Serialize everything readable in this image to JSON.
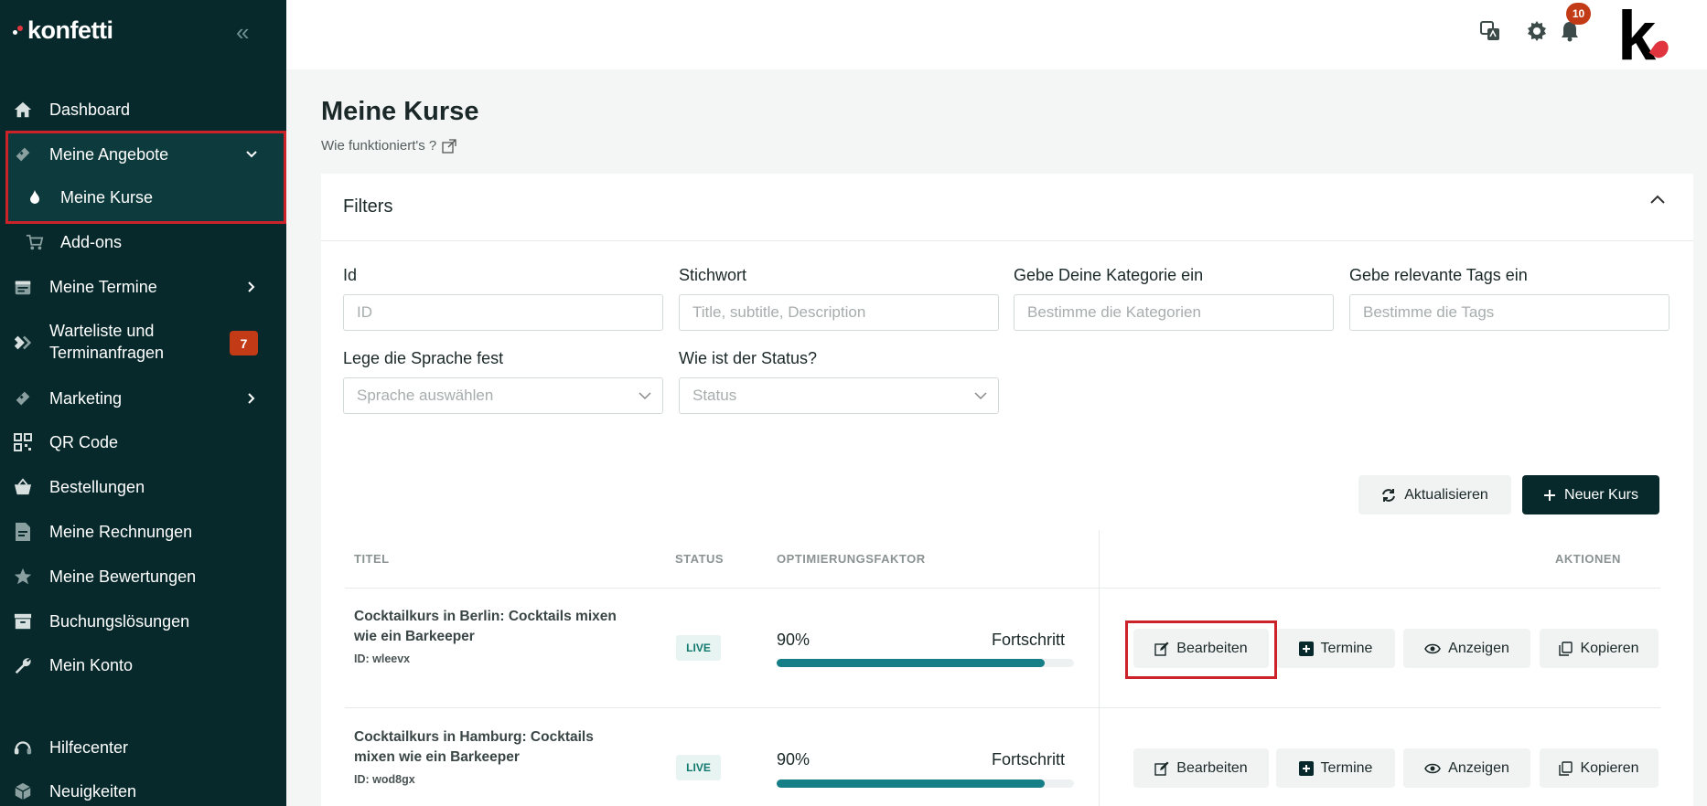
{
  "brand": {
    "name": "konfetti"
  },
  "sidebar": {
    "items": [
      {
        "label": "Dashboard",
        "icon": "home-icon"
      },
      {
        "label": "Meine Angebote",
        "icon": "ticket-icon"
      },
      {
        "label": "Meine Kurse",
        "icon": "flame-icon"
      },
      {
        "label": "Add-ons",
        "icon": "cart-icon"
      },
      {
        "label": "Meine Termine",
        "icon": "calendar-icon"
      },
      {
        "label": "Warteliste und Terminanfragen",
        "line1": "Warteliste und",
        "line2": "Terminanfragen",
        "icon": "waitlist-icon",
        "badge": "7"
      },
      {
        "label": "Marketing",
        "icon": "megaphone-icon"
      },
      {
        "label": "QR Code",
        "icon": "qr-code-icon"
      },
      {
        "label": "Bestellungen",
        "icon": "basket-icon"
      },
      {
        "label": "Meine Rechnungen",
        "icon": "invoice-icon"
      },
      {
        "label": "Meine Bewertungen",
        "icon": "star-icon"
      },
      {
        "label": "Buchungslösungen",
        "icon": "archive-icon"
      },
      {
        "label": "Mein Konto",
        "icon": "wrench-icon"
      },
      {
        "label": "Hilfecenter",
        "icon": "headset-icon"
      },
      {
        "label": "Neuigkeiten",
        "icon": "cube-icon"
      }
    ]
  },
  "topbar": {
    "notifications": "10"
  },
  "page": {
    "title": "Meine Kurse",
    "help": "Wie funktioniert's ?"
  },
  "filters": {
    "title": "Filters",
    "id_label": "Id",
    "id_placeholder": "ID",
    "keyword_label": "Stichwort",
    "keyword_placeholder": "Title, subtitle, Description",
    "category_label": "Gebe Deine Kategorie ein",
    "category_placeholder": "Bestimme die Kategorien",
    "tags_label": "Gebe relevante Tags ein",
    "tags_placeholder": "Bestimme die Tags",
    "language_label": "Lege die Sprache fest",
    "language_placeholder": "Sprache auswählen",
    "status_label": "Wie ist der Status?",
    "status_placeholder": "Status"
  },
  "toolbar": {
    "refresh": "Aktualisieren",
    "new_course": "Neuer Kurs"
  },
  "table": {
    "headers": [
      "TITEL",
      "STATUS",
      "OPTIMIERUNGSFAKTOR",
      "AKTIONEN"
    ],
    "progress_label": "Fortschritt",
    "actions": [
      "Bearbeiten",
      "Termine",
      "Anzeigen",
      "Kopieren"
    ],
    "rows": [
      {
        "title_line1": "Cocktailkurs in Berlin: Cocktails mixen",
        "title_line2": "wie ein Barkeeper",
        "id": "ID: wleevx",
        "status": "LIVE",
        "progress": "90%",
        "progress_value": 0.9
      },
      {
        "title_line1": "Cocktailkurs in Hamburg: Cocktails",
        "title_line2": "mixen wie ein Barkeeper",
        "id": "ID: wod8gx",
        "status": "LIVE",
        "progress": "90%",
        "progress_value": 0.9
      }
    ]
  },
  "colors": {
    "sidebar_bg": "#07292b",
    "accent": "#157e86",
    "badge": "#c33b16",
    "highlight": "#cc2229"
  }
}
